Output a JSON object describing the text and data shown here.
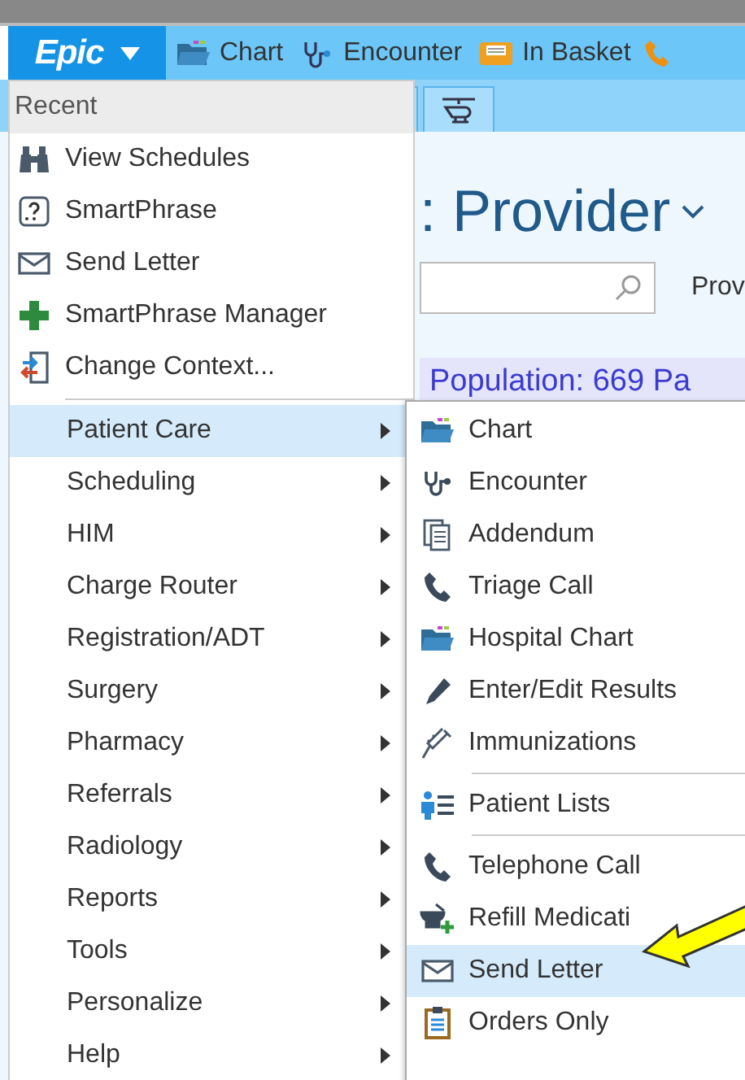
{
  "toolbar": {
    "logo": "Epic",
    "items": [
      {
        "label": "Chart"
      },
      {
        "label": "Encounter"
      },
      {
        "label": "In Basket"
      }
    ]
  },
  "background": {
    "title": ": Provider",
    "filter_label": "Prov",
    "population": "Population: 669 Pa"
  },
  "menu": {
    "header": "Recent",
    "recent": [
      {
        "label": "View Schedules"
      },
      {
        "label": "SmartPhrase"
      },
      {
        "label": "Send Letter"
      },
      {
        "label": "SmartPhrase Manager"
      },
      {
        "label": "Change Context..."
      }
    ],
    "categories": [
      {
        "label": "Patient Care",
        "selected": true
      },
      {
        "label": "Scheduling",
        "selected": false
      },
      {
        "label": "HIM",
        "selected": false
      },
      {
        "label": "Charge Router",
        "selected": false
      },
      {
        "label": "Registration/ADT",
        "selected": false
      },
      {
        "label": "Surgery",
        "selected": false
      },
      {
        "label": "Pharmacy",
        "selected": false
      },
      {
        "label": "Referrals",
        "selected": false
      },
      {
        "label": "Radiology",
        "selected": false
      },
      {
        "label": "Reports",
        "selected": false
      },
      {
        "label": "Tools",
        "selected": false
      },
      {
        "label": "Personalize",
        "selected": false
      },
      {
        "label": "Help",
        "selected": false
      }
    ]
  },
  "submenu": [
    {
      "label": "Chart",
      "selected": false,
      "divider_after": false
    },
    {
      "label": "Encounter",
      "selected": false,
      "divider_after": false
    },
    {
      "label": "Addendum",
      "selected": false,
      "divider_after": false
    },
    {
      "label": "Triage Call",
      "selected": false,
      "divider_after": false
    },
    {
      "label": "Hospital Chart",
      "selected": false,
      "divider_after": false
    },
    {
      "label": "Enter/Edit Results",
      "selected": false,
      "divider_after": false
    },
    {
      "label": "Immunizations",
      "selected": false,
      "divider_after": true
    },
    {
      "label": "Patient Lists",
      "selected": false,
      "divider_after": true
    },
    {
      "label": "Telephone Call",
      "selected": false,
      "divider_after": false
    },
    {
      "label": "Refill Medicati",
      "selected": false,
      "divider_after": false
    },
    {
      "label": "Send Letter",
      "selected": true,
      "divider_after": false
    },
    {
      "label": "Orders Only",
      "selected": false,
      "divider_after": false
    }
  ]
}
